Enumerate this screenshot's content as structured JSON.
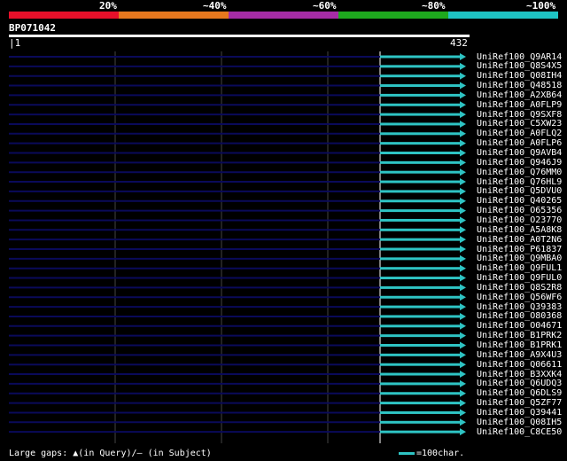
{
  "identity_legend": {
    "labels": [
      "20%",
      "~40%",
      "~60%",
      "~80%",
      "~100%"
    ],
    "colors": [
      "#e8102a",
      "#e8781e",
      "#a62ca6",
      "#1ea91e",
      "#1ec4c4"
    ]
  },
  "query": {
    "id": "BP071042",
    "start": "1",
    "end": "432"
  },
  "hits": [
    "UniRef100_Q9AR14",
    "UniRef100_Q8S4X5",
    "UniRef100_Q08IH4",
    "UniRef100_Q48518",
    "UniRef100_A2XB64",
    "UniRef100_A0FLP9",
    "UniRef100_Q9SXF8",
    "UniRef100_C5XW23",
    "UniRef100_A0FLQ2",
    "UniRef100_A0FLP6",
    "UniRef100_Q9AVB4",
    "UniRef100_Q946J9",
    "UniRef100_Q76MM0",
    "UniRef100_Q76HL9",
    "UniRef100_Q5DVU0",
    "UniRef100_Q40265",
    "UniRef100_O65356",
    "UniRef100_O23770",
    "UniRef100_A5A8K8",
    "UniRef100_A0T2N6",
    "UniRef100_P61837",
    "UniRef100_Q9MBA0",
    "UniRef100_Q9FUL1",
    "UniRef100_Q9FUL0",
    "UniRef100_Q8S2R8",
    "UniRef100_Q56WF6",
    "UniRef100_Q39383",
    "UniRef100_O80368",
    "UniRef100_O04671",
    "UniRef100_B1PRK2",
    "UniRef100_B1PRK1",
    "UniRef100_A9X4U3",
    "UniRef100_Q06611",
    "UniRef100_B3XXK4",
    "UniRef100_Q6UDQ3",
    "UniRef100_Q6DLS9",
    "UniRef100_Q5ZF77",
    "UniRef100_Q39441",
    "UniRef100_Q08IH5",
    "UniRef100_C8CE50"
  ],
  "footer": {
    "gaps_prefix": "Large gaps: ",
    "query_gap_symbol": "▲",
    "query_gap_text": "(in Query)/",
    "subject_gap_symbol": "–",
    "subject_gap_text": " (in Subject)",
    "scale_text": "=100char."
  },
  "colors": {
    "hit_color": "#2ec4c4",
    "unaligned_color": "#0a0a5a",
    "grid_color": "#444444"
  }
}
